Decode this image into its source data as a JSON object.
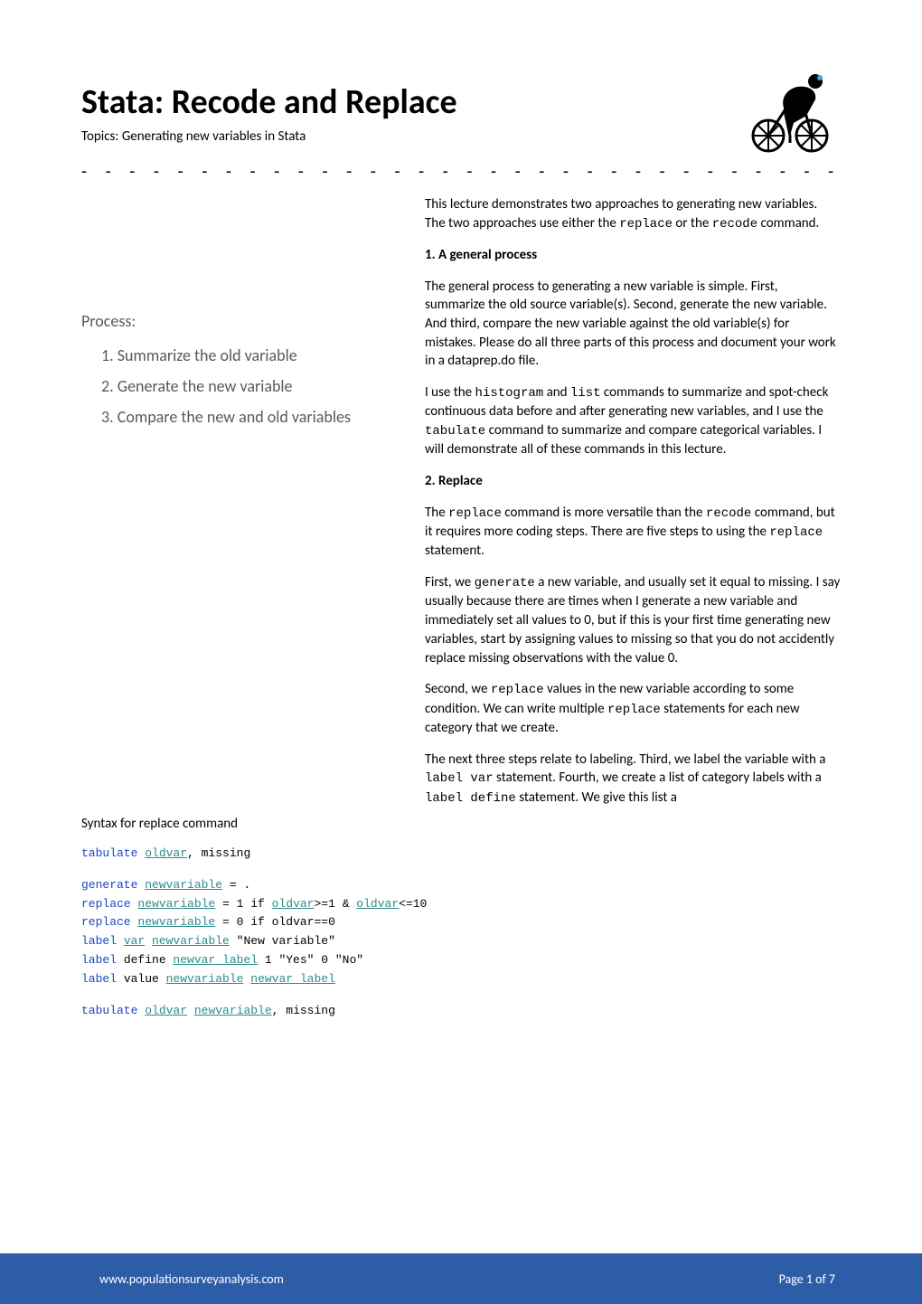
{
  "header": {
    "title": "Stata: Recode and Replace",
    "topics_label": "Topics: ",
    "topics_value": "Generating new variables in Stata",
    "separator": "- - - - - - - - - - - - - - - - - - - - - - - - - - - - - - - - - - - - - - -"
  },
  "right": {
    "intro": "This lecture demonstrates two approaches to generating new variables. The two approaches use either the ",
    "intro_code1": "replace",
    "intro_mid": " or the ",
    "intro_code2": "recode",
    "intro_end": " command.",
    "s1_head": "1.   A general process",
    "s1_p1": "The general process to generating a new variable is simple. First, summarize the old source variable(s). Second, generate the new variable. And third, compare the new variable against the old variable(s) for mistakes. Please do all three parts of this process and document your work in a dataprep.do file.",
    "s1_p2a": "I use the ",
    "s1_p2_code1": "histogram",
    "s1_p2b": " and ",
    "s1_p2_code2": "list",
    "s1_p2c": " commands to summarize and spot-check continuous data before and after generating new variables, and I use the ",
    "s1_p2_code3": "tabulate",
    "s1_p2d": " command to summarize and compare categorical variables. I will demonstrate all of these commands in this lecture.",
    "s2_head": "2.   Replace",
    "s2_p1a": "The ",
    "s2_p1_code1": "replace",
    "s2_p1b": " command is more versatile than the ",
    "s2_p1_code2": "recode",
    "s2_p1c": " command, but it requires more coding steps. There are five steps to using the ",
    "s2_p1_code3": "replace",
    "s2_p1d": " statement.",
    "s2_p2a": "First, we ",
    "s2_p2_code1": "generate",
    "s2_p2b": " a new variable, and usually set it equal to missing. I say usually because there are times when I generate a new variable and immediately set all values to 0, but if this is your first time generating new variables, start by assigning values to missing so that you do not accidently replace missing observations with the value 0.",
    "s2_p3a": "Second, we ",
    "s2_p3_code1": "replace",
    "s2_p3b": " values in the new variable according to some condition. We can write multiple ",
    "s2_p3_code2": "replace",
    "s2_p3c": " statements for each new category that we create.",
    "s2_p4a": "The next three steps relate to labeling. Third, we label the variable with a ",
    "s2_p4_code1": "label var",
    "s2_p4b": " statement. Fourth, we create a list of category labels with a ",
    "s2_p4_code2": "label define",
    "s2_p4c": " statement. We give this list a"
  },
  "process": {
    "title": "Process:",
    "items": [
      "1. Summarize the old variable",
      "2. Generate the new variable",
      "3. Compare the new and old variables"
    ]
  },
  "syntax": {
    "title": "Syntax for replace command",
    "l1_a": "tabulate ",
    "l1_b": "oldvar",
    "l1_c": ", missing",
    "l2_a": "generate ",
    "l2_b": "newvariable",
    "l2_c": " = .",
    "l3_a": "replace ",
    "l3_b": "newvariable",
    "l3_c": " = 1 if ",
    "l3_d": "oldvar",
    "l3_e": ">=1 & ",
    "l3_f": "oldvar",
    "l3_g": "<=10",
    "l4_a": "replace ",
    "l4_b": "newvariable",
    "l4_c": " = 0 if oldvar==0",
    "l5_a": "label ",
    "l5_b": "var",
    "l5_c": " ",
    "l5_d": "newvariable",
    "l5_e": " \"New variable\"",
    "l6_a": "label ",
    "l6_b": "define ",
    "l6_c": "newvar_label",
    "l6_d": " 1 \"Yes\" 0 \"No\"",
    "l7_a": "label ",
    "l7_b": "value ",
    "l7_c": "newvariable",
    "l7_d": " ",
    "l7_e": "newvar_label",
    "l8_a": "tabulate ",
    "l8_b": "oldvar",
    "l8_c": " ",
    "l8_d": "newvariable",
    "l8_e": ", missing"
  },
  "footer": {
    "site": "www.populationsurveyanalysis.com",
    "page": "Page 1 of 7"
  }
}
